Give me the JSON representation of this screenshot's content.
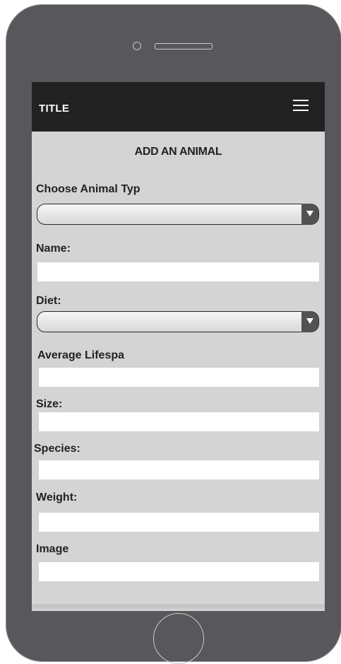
{
  "app": {
    "title": "TITLE"
  },
  "page": {
    "title": "ADD AN ANIMAL"
  },
  "form": {
    "animal_type": {
      "label": "Choose Animal Typ",
      "value": ""
    },
    "name": {
      "label": "Name:",
      "value": ""
    },
    "diet": {
      "label": "Diet:",
      "value": ""
    },
    "lifespan": {
      "label": "Average Lifespa",
      "value": ""
    },
    "size": {
      "label": "Size:",
      "value": ""
    },
    "species": {
      "label": "Species:",
      "value": ""
    },
    "weight": {
      "label": "Weight:",
      "value": ""
    },
    "image": {
      "label": "Image",
      "value": ""
    }
  },
  "icons": {
    "menu": "hamburger-menu-icon",
    "home": "home-button"
  }
}
